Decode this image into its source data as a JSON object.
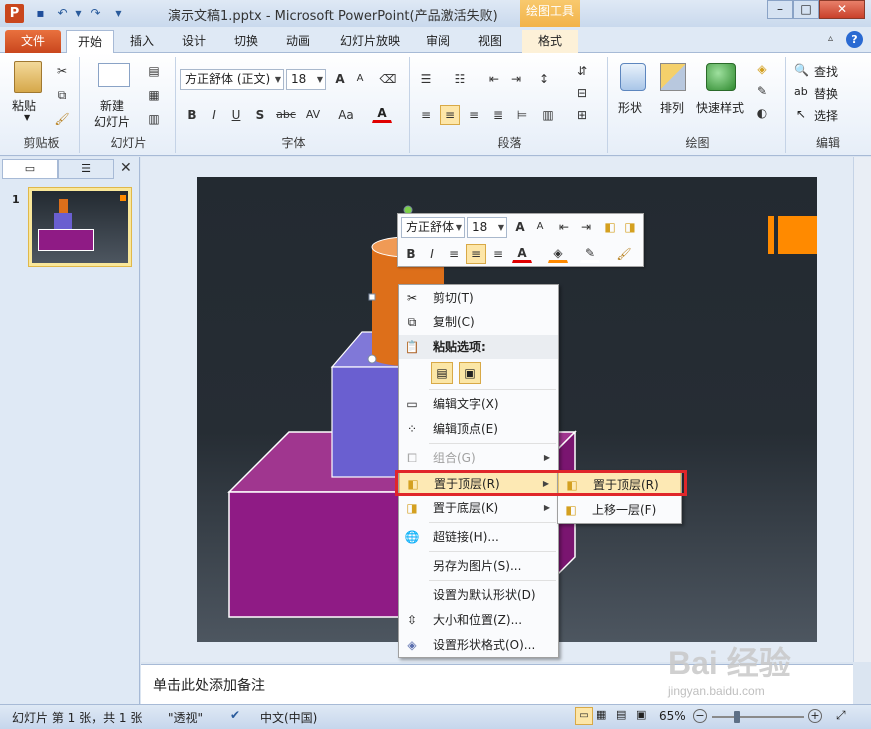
{
  "window": {
    "title": "演示文稿1.pptx - Microsoft PowerPoint(产品激活失败)",
    "context_tab_group": "绘图工具",
    "app_icon": "P",
    "min": "–",
    "max": "□",
    "close": "✕"
  },
  "tabs": {
    "file": "文件",
    "home": "开始",
    "insert": "插入",
    "design": "设计",
    "transitions": "切换",
    "animations": "动画",
    "slideshow": "幻灯片放映",
    "review": "审阅",
    "view": "视图",
    "format": "格式"
  },
  "ribbon": {
    "clipboard": {
      "paste": "粘贴",
      "label": "剪贴板"
    },
    "slides": {
      "new_slide_line1": "新建",
      "new_slide_line2": "幻灯片",
      "label": "幻灯片"
    },
    "font": {
      "font_name": "方正舒体 (正文)",
      "font_size": "18",
      "label": "字体",
      "bold": "B",
      "italic": "I",
      "underline": "U",
      "shadow": "S",
      "strike": "abc",
      "spacing": "AV",
      "case": "Aa",
      "color": "A",
      "grow": "A",
      "shrink": "A"
    },
    "paragraph": {
      "label": "段落"
    },
    "drawing": {
      "shapes": "形状",
      "arrange": "排列",
      "quick_styles": "快速样式",
      "label": "绘图"
    },
    "editing": {
      "find": "查找",
      "replace": "替换",
      "select": "选择",
      "label": "编辑"
    }
  },
  "left_panel": {
    "slide_number": "1"
  },
  "mini_toolbar": {
    "font_name": "方正舒体",
    "font_size": "18"
  },
  "context_menu": {
    "items": [
      {
        "label": "剪切(T)"
      },
      {
        "label": "复制(C)"
      },
      {
        "label": "粘贴选项:"
      },
      {
        "label": "编辑文字(X)"
      },
      {
        "label": "编辑顶点(E)"
      },
      {
        "label": "组合(G)"
      },
      {
        "label": "置于顶层(R)"
      },
      {
        "label": "置于底层(K)"
      },
      {
        "label": "超链接(H)..."
      },
      {
        "label": "另存为图片(S)..."
      },
      {
        "label": "设置为默认形状(D)"
      },
      {
        "label": "大小和位置(Z)..."
      },
      {
        "label": "设置形状格式(O)..."
      }
    ]
  },
  "submenu": {
    "items": [
      {
        "label": "置于顶层(R)"
      },
      {
        "label": "上移一层(F)"
      }
    ]
  },
  "notes": {
    "placeholder": "单击此处添加备注"
  },
  "status": {
    "slide_info": "幻灯片 第 1 张，共 1 张",
    "theme": "\"透视\"",
    "language": "中文(中国)",
    "zoom": "65%"
  },
  "watermark": {
    "text": "Bai 经验",
    "url": "jingyan.baidu.com"
  },
  "colors": {
    "accent_orange": "#ff8a00",
    "cylinder_orange": "#dd6f1a",
    "cube_purple": "#6a5fd0",
    "box_magenta": "#8f1b85",
    "highlight_red": "#e0262a"
  }
}
